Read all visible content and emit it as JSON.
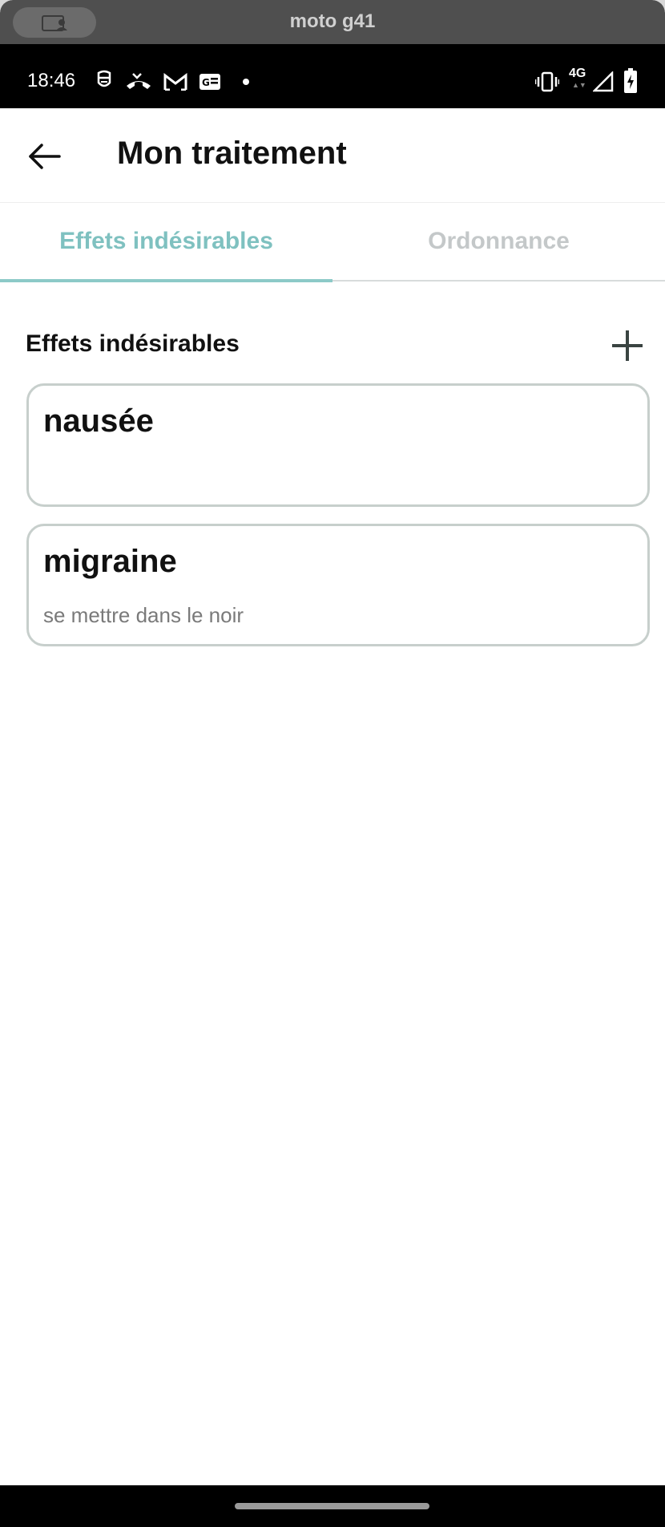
{
  "device": {
    "name": "moto g41"
  },
  "status_bar": {
    "time": "18:46",
    "network": "4G",
    "icons": [
      "face-icon",
      "missed-call-icon",
      "gmail-icon",
      "news-icon",
      "dot-icon",
      "vibrate-icon",
      "network-4g-icon",
      "signal-icon",
      "battery-charging-icon"
    ]
  },
  "app_bar": {
    "title": "Mon traitement",
    "back_icon": "arrow-left-icon"
  },
  "tabs": [
    {
      "label": "Effets indésirables",
      "active": true
    },
    {
      "label": "Ordonnance",
      "active": false
    }
  ],
  "section": {
    "title": "Effets indésirables",
    "add_icon": "plus-icon"
  },
  "effects": [
    {
      "name": "nausée",
      "note": ""
    },
    {
      "name": "migraine",
      "note": "se mettre dans le noir"
    }
  ],
  "colors": {
    "accent": "#7fc1c0",
    "inactive_tab": "#c4c8c9",
    "card_border": "#c7cfcc"
  }
}
